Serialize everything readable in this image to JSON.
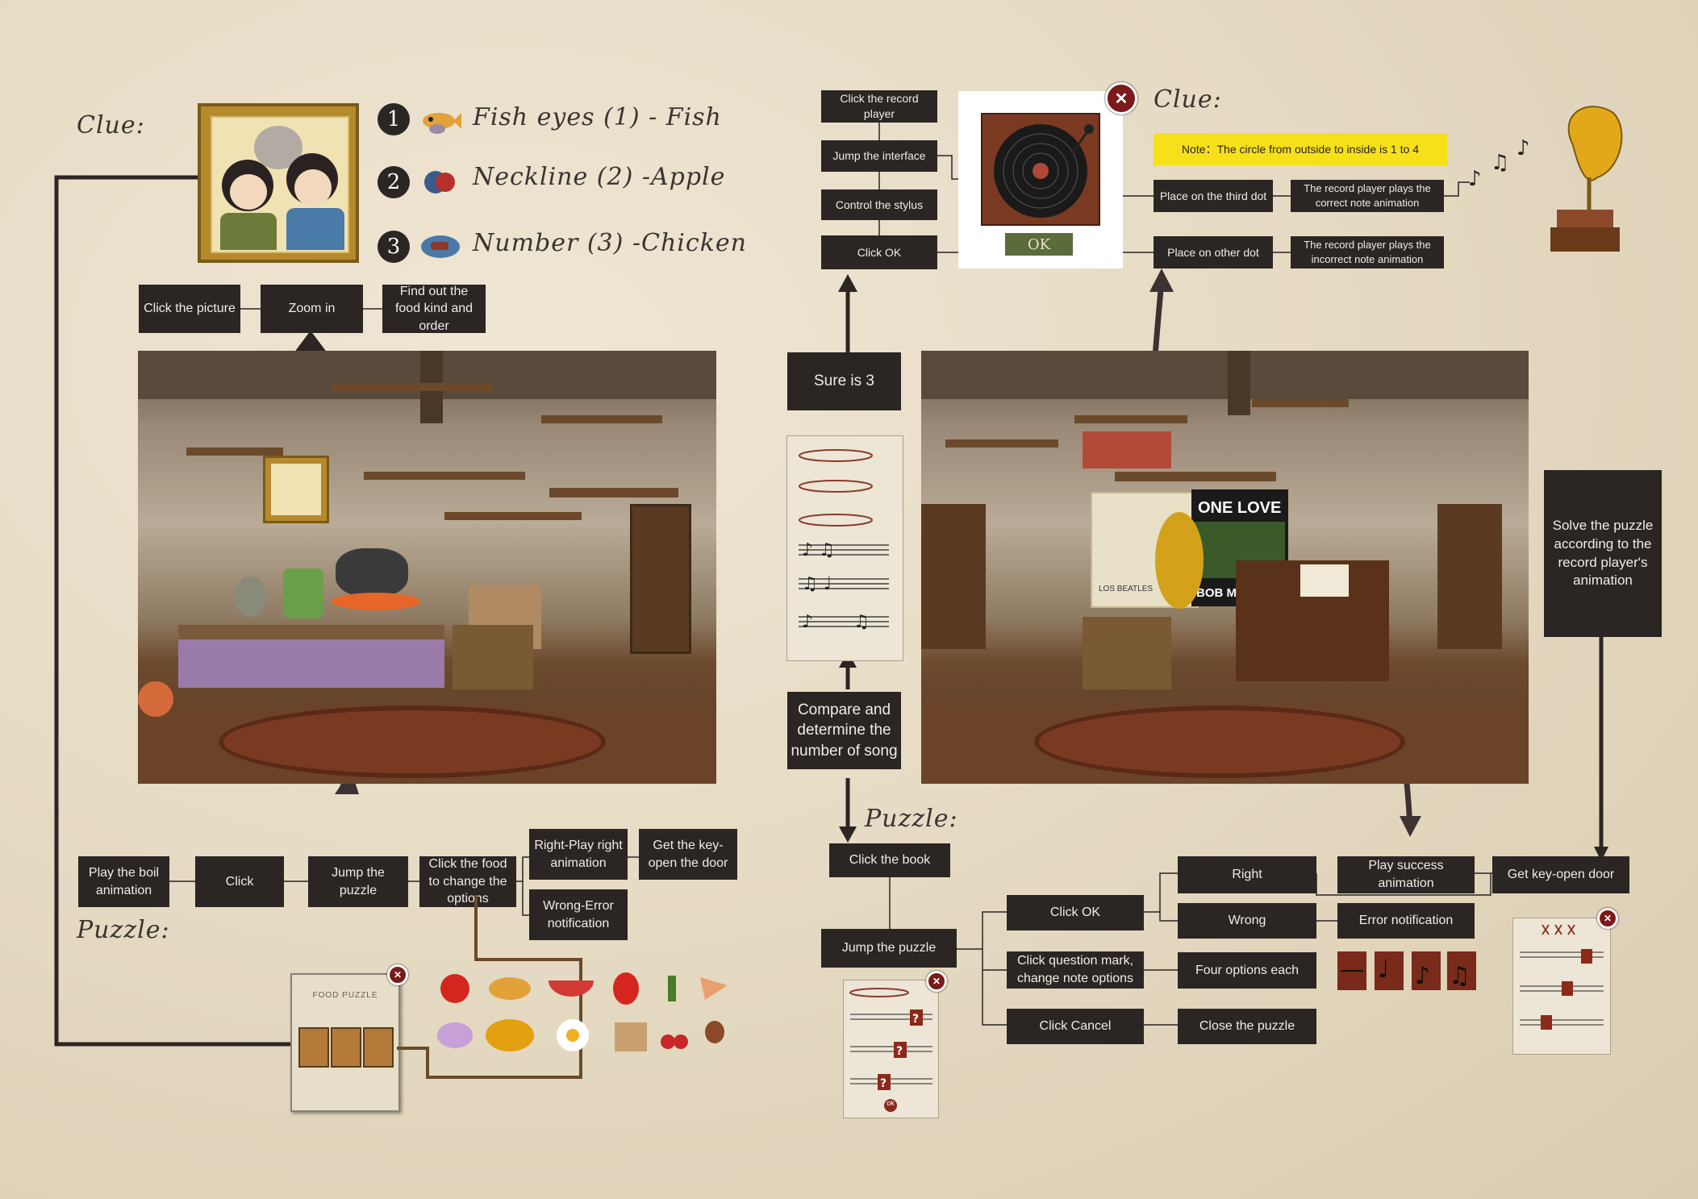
{
  "left": {
    "clue_title": "Clue:",
    "clue_items": [
      {
        "num": "1",
        "text": "Fish eyes (1) - Fish"
      },
      {
        "num": "2",
        "text": "Neckline (2) -Apple"
      },
      {
        "num": "3",
        "text": "Number (3) -Chicken"
      }
    ],
    "flow_top": [
      "Click the picture",
      "Zoom in",
      "Find out the food kind and order"
    ],
    "flow_bottom": [
      "Play the boil animation",
      "Click",
      "Jump the puzzle",
      "Click the food to change the options"
    ],
    "right_play": "Right-Play right animation",
    "get_key": "Get the key-open the door",
    "wrong": "Wrong-Error notification",
    "puzzle_title": "Puzzle:",
    "food_puzzle_label": "FOOD PUZZLE"
  },
  "middle": {
    "sure": "Sure is 3",
    "compare": "Compare and determine the number of song",
    "puzzle_title": "Puzzle:",
    "click_book": "Click the book",
    "jump_puzzle": "Jump the puzzle",
    "ok_small": "ok"
  },
  "right_top": {
    "flow": [
      "Click the record player",
      "Jump the interface",
      "Control the stylus",
      "Click OK"
    ],
    "ok_label": "OK",
    "clue_title": "Clue:",
    "note": "Note：The circle from outside to inside is 1 to 4",
    "third_dot": "Place on the third dot",
    "other_dot": "Place on other dot",
    "correct_anim": "The record player plays the correct note animation",
    "incorrect_anim": "The record player plays the incorrect note animation"
  },
  "right_scene": {
    "poster_text": "ONE LOVE",
    "poster2": "BOB M",
    "poster3": "LOS BEATLES"
  },
  "right_side": {
    "solve": "Solve the puzzle according to the record player's animation"
  },
  "right_bottom": {
    "click_ok": "Click OK",
    "click_question": "Click question mark, change note options",
    "click_cancel": "Click Cancel",
    "right": "Right",
    "wrong": "Wrong",
    "four_options": "Four options each",
    "close_puzzle": "Close the puzzle",
    "play_success": "Play success animation",
    "get_key": "Get key-open door",
    "error_notification": "Error notification"
  },
  "colors": {
    "box": "#2b2523",
    "paper": "#e6dbc4",
    "note_yellow": "#f5e01a",
    "record_red": "#7a3a22",
    "ok_green": "#5b6b3a",
    "close_red": "#7a1a1a"
  }
}
